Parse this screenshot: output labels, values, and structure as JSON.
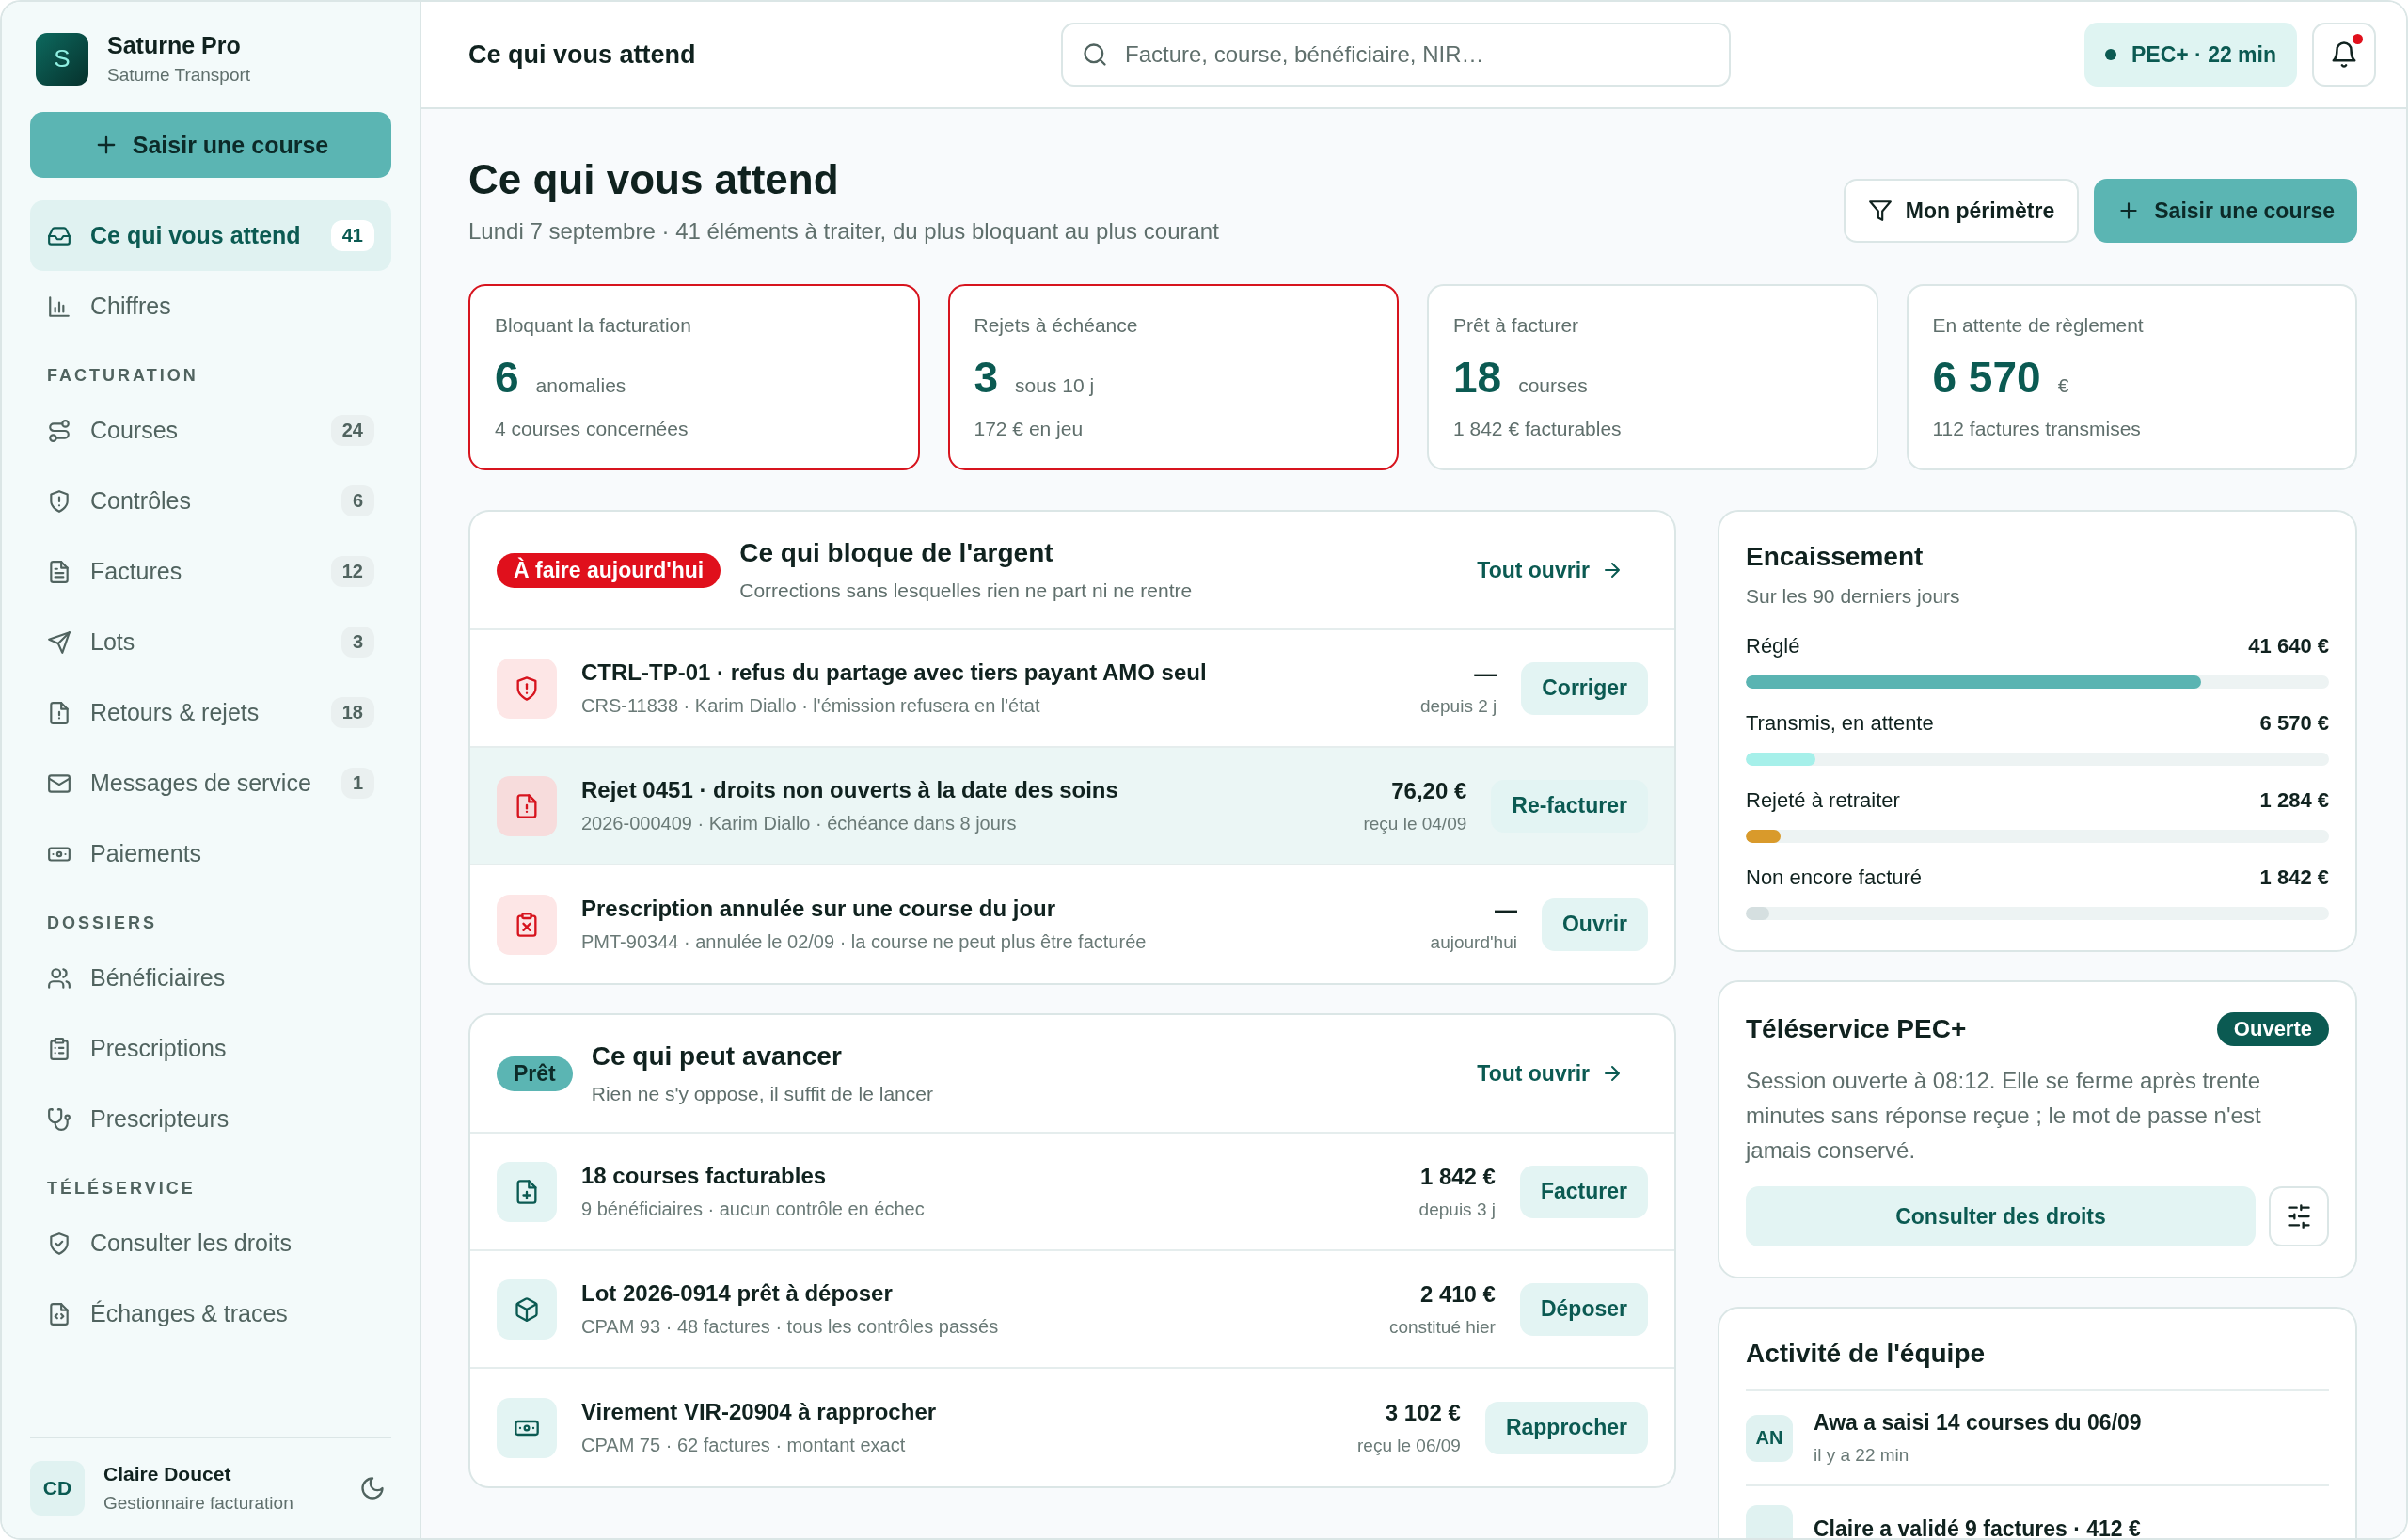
{
  "sidebar": {
    "brand": {
      "initial": "S",
      "name": "Saturne Pro",
      "subtitle": "Saturne Transport"
    },
    "primary_action": "Saisir une course",
    "groups": [
      {
        "items": [
          {
            "label": "Ce qui vous attend",
            "count": "41",
            "selected": true
          },
          {
            "label": "Chiffres",
            "selected": false
          }
        ]
      },
      {
        "heading": "FACTURATION",
        "items": [
          {
            "label": "Courses",
            "count": "24",
            "selected": false
          },
          {
            "label": "Contrôles",
            "count": "6",
            "selected": false
          },
          {
            "label": "Factures",
            "count": "12",
            "selected": false
          },
          {
            "label": "Lots",
            "count": "3",
            "selected": false
          },
          {
            "label": "Retours & rejets",
            "count": "18",
            "selected": false
          },
          {
            "label": "Messages de service",
            "count": "1",
            "selected": false
          },
          {
            "label": "Paiements",
            "selected": false
          }
        ]
      },
      {
        "heading": "DOSSIERS",
        "items": [
          {
            "label": "Bénéficiaires",
            "selected": false
          },
          {
            "label": "Prescriptions",
            "selected": false
          },
          {
            "label": "Prescripteurs",
            "selected": false
          }
        ]
      },
      {
        "heading": "TÉLÉSERVICE",
        "items": [
          {
            "label": "Consulter les droits",
            "selected": false
          },
          {
            "label": "Échanges & traces",
            "selected": false
          }
        ]
      }
    ],
    "user": {
      "initials": "CD",
      "name": "Claire Doucet",
      "role": "Gestionnaire facturation"
    }
  },
  "header": {
    "title": "Ce qui vous attend",
    "search": {
      "placeholder": "Facture, course, bénéficiaire, NIR…"
    },
    "session": "PEC+ · 22 min",
    "notifications_unread": true
  },
  "page": {
    "title": "Ce qui vous attend",
    "subtitle": "Lundi 7 septembre · 41 éléments à traiter, du plus bloquant au plus courant",
    "filter_button": "Mon périmètre",
    "primary_button": "Saisir une course"
  },
  "kpis": [
    {
      "label": "Bloquant la facturation",
      "value": "6",
      "unit": "anomalies",
      "note": "4 courses concernées",
      "alert": true
    },
    {
      "label": "Rejets à échéance",
      "value": "3",
      "unit": "sous 10 j",
      "note": "172 € en jeu",
      "alert": true
    },
    {
      "label": "Prêt à facturer",
      "value": "18",
      "unit": "courses",
      "note": "1 842 € facturables",
      "alert": false
    },
    {
      "label": "En attente de règlement",
      "value": "6 570",
      "unit": "€",
      "note": "112 factures transmises",
      "alert": false
    }
  ],
  "panels": [
    {
      "badge": {
        "text": "À faire aujourd'hui",
        "kind": "urgent"
      },
      "title": "Ce qui bloque de l'argent",
      "subtitle": "Corrections sans lesquelles rien ne part ni ne rentre",
      "link": "Tout ouvrir",
      "rows": [
        {
          "title": "CTRL-TP-01 · refus du partage avec tiers payant AMO seul",
          "meta": "CRS-11838 · Karim Diallo · l'émission refusera en l'état",
          "amount": "—",
          "when": "depuis 2 j",
          "action": "Corriger",
          "selected": false
        },
        {
          "title": "Rejet 0451 · droits non ouverts à la date des soins",
          "meta": "2026-000409 · Karim Diallo · échéance dans 8 jours",
          "amount": "76,20 €",
          "when": "reçu le 04/09",
          "action": "Re-facturer",
          "selected": true
        },
        {
          "title": "Prescription annulée sur une course du jour",
          "meta": "PMT-90344 · annulée le 02/09 · la course ne peut plus être facturée",
          "amount": "—",
          "when": "aujourd'hui",
          "action": "Ouvrir",
          "selected": false
        }
      ]
    },
    {
      "badge": {
        "text": "Prêt",
        "kind": "ready"
      },
      "title": "Ce qui peut avancer",
      "subtitle": "Rien ne s'y oppose, il suffit de le lancer",
      "link": "Tout ouvrir",
      "rows": [
        {
          "title": "18 courses facturables",
          "meta": "9 bénéficiaires · aucun contrôle en échec",
          "amount": "1 842 €",
          "when": "depuis 3 j",
          "action": "Facturer",
          "selected": false
        },
        {
          "title": "Lot 2026-0914 prêt à déposer",
          "meta": "CPAM 93 · 48 factures · tous les contrôles passés",
          "amount": "2 410 €",
          "when": "constitué hier",
          "action": "Déposer",
          "selected": false
        },
        {
          "title": "Virement VIR-20904 à rapprocher",
          "meta": "CPAM 75 · 62 factures · montant exact",
          "amount": "3 102 €",
          "when": "reçu le 06/09",
          "action": "Rapprocher",
          "selected": false
        }
      ]
    }
  ],
  "collections": {
    "title": "Encaissement",
    "subtitle": "Sur les 90 derniers jours",
    "bars": [
      {
        "label": "Réglé",
        "amount": "41 640 €",
        "level": 0.78,
        "color": "#5ab4b2"
      },
      {
        "label": "Transmis, en attente",
        "amount": "6 570 €",
        "level": 0.12,
        "color": "#a6f0ea"
      },
      {
        "label": "Rejeté à retraiter",
        "amount": "1 284 €",
        "level": 0.06,
        "color": "#d99a2b"
      },
      {
        "label": "Non encore facturé",
        "amount": "1 842 €",
        "level": 0.04,
        "color": "#d5dfe0"
      }
    ]
  },
  "teleservice": {
    "title": "Téléservice PEC+",
    "status": "Ouverte",
    "open": true,
    "text": "Session ouverte à 08:12. Elle se ferme après trente minutes sans réponse reçue ; le mot de passe n'est jamais conservé.",
    "button": "Consulter des droits"
  },
  "activity": {
    "title": "Activité de l'équipe",
    "items": [
      {
        "initials": "AN",
        "text": "Awa a saisi 14 courses du 06/09",
        "time": "il y a 22 min"
      },
      {
        "text": "Claire a validé 9 factures · 412 €"
      }
    ]
  }
}
